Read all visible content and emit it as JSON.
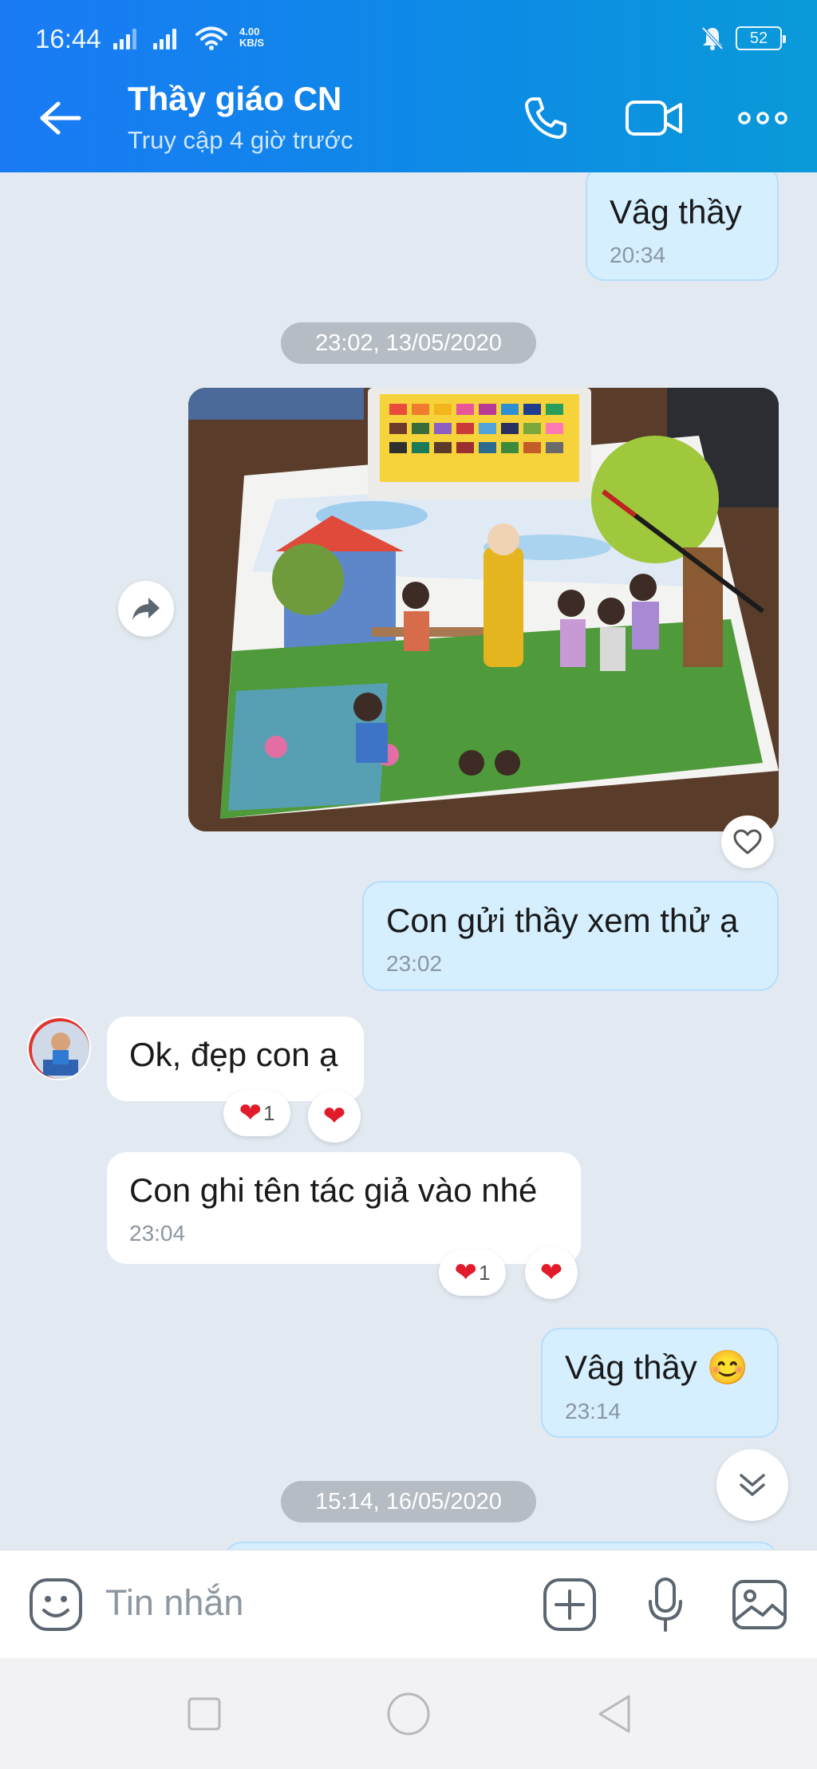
{
  "status_bar": {
    "time": "16:44",
    "net_speed_value": "4.00",
    "net_speed_unit": "KB/S",
    "battery": "52"
  },
  "app_bar": {
    "contact_name": "Thầy giáo CN",
    "last_seen": "Truy cập 4 giờ trước"
  },
  "messages": [
    {
      "direction": "out",
      "text": "Vâg thầy",
      "time": "20:34"
    },
    {
      "type": "date",
      "text": "23:02, 13/05/2020"
    },
    {
      "direction": "out",
      "type": "image",
      "description": "watercolor drawing"
    },
    {
      "direction": "out",
      "text": "Con gửi thầy xem thử ạ",
      "time": "23:02"
    },
    {
      "direction": "in",
      "text": "Ok, đẹp con ạ",
      "reaction_count": "1"
    },
    {
      "direction": "in",
      "text": "Con ghi tên tác giả vào nhé",
      "time": "23:04",
      "reaction_count": "1"
    },
    {
      "direction": "out",
      "text": "Vâg thầy 😊",
      "time": "23:14"
    },
    {
      "type": "date",
      "text": "15:14, 16/05/2020"
    }
  ],
  "input": {
    "placeholder": "Tin nhắn"
  },
  "colors": {
    "header_start": "#1a7af5",
    "header_end": "#0a9ad9",
    "chat_bg": "#e2e9f1",
    "out_bubble": "#d5efff",
    "in_bubble": "#ffffff",
    "heart": "#e21b2b"
  }
}
